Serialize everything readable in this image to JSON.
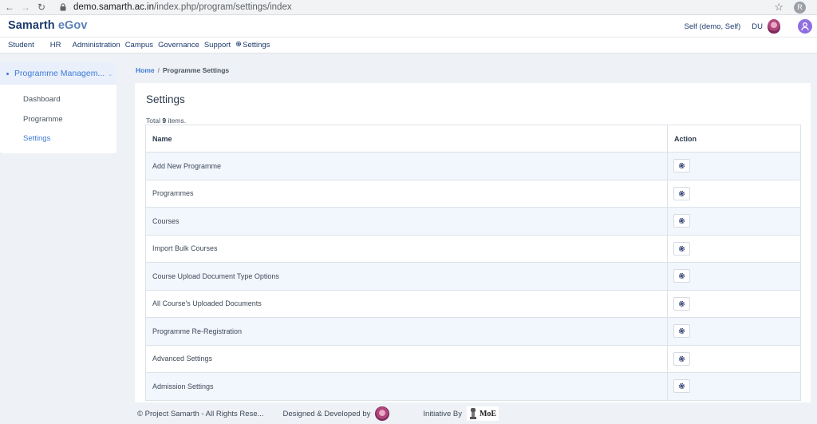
{
  "browser": {
    "url_host": "demo.samarth.ac.in",
    "url_path": "/index.php/program/settings/index",
    "profile_initial": "R"
  },
  "header": {
    "logo_part1": "Samarth",
    "logo_part2": "eGov",
    "user_label": "Self (demo, Self)",
    "org_label": "DU"
  },
  "nav": {
    "items": [
      "Student",
      "HR",
      "Administration",
      "Campus",
      "Governance",
      "Support",
      "Settings"
    ]
  },
  "sidebar": {
    "title": "Programme Managem...",
    "links": [
      "Dashboard",
      "Programme",
      "Settings"
    ]
  },
  "breadcrumb": {
    "home": "Home",
    "separator": "/",
    "current": "Programme Settings"
  },
  "main": {
    "title": "Settings",
    "summary_prefix": "Total",
    "summary_count": "9",
    "summary_suffix": "items.",
    "columns": [
      "Name",
      "Action"
    ],
    "rows": [
      "Add New Programme",
      "Programmes",
      "Courses",
      "Import Bulk Courses",
      "Course Upload Document Type Options",
      "All Course's Uploaded Documents",
      "Programme Re-Registration",
      "Advanced Settings",
      "Admission Settings"
    ]
  },
  "footer": {
    "copyright": "© Project Samarth - All Rights Rese...",
    "designed": "Designed & Developed by",
    "initiative": "Initiative By",
    "moe": "MoE"
  },
  "colors": {
    "brand_dark": "#1d3b6e",
    "brand_light": "#5b7fb6",
    "accent": "#3f7ad6",
    "row_stripe": "#f2f6fd"
  }
}
